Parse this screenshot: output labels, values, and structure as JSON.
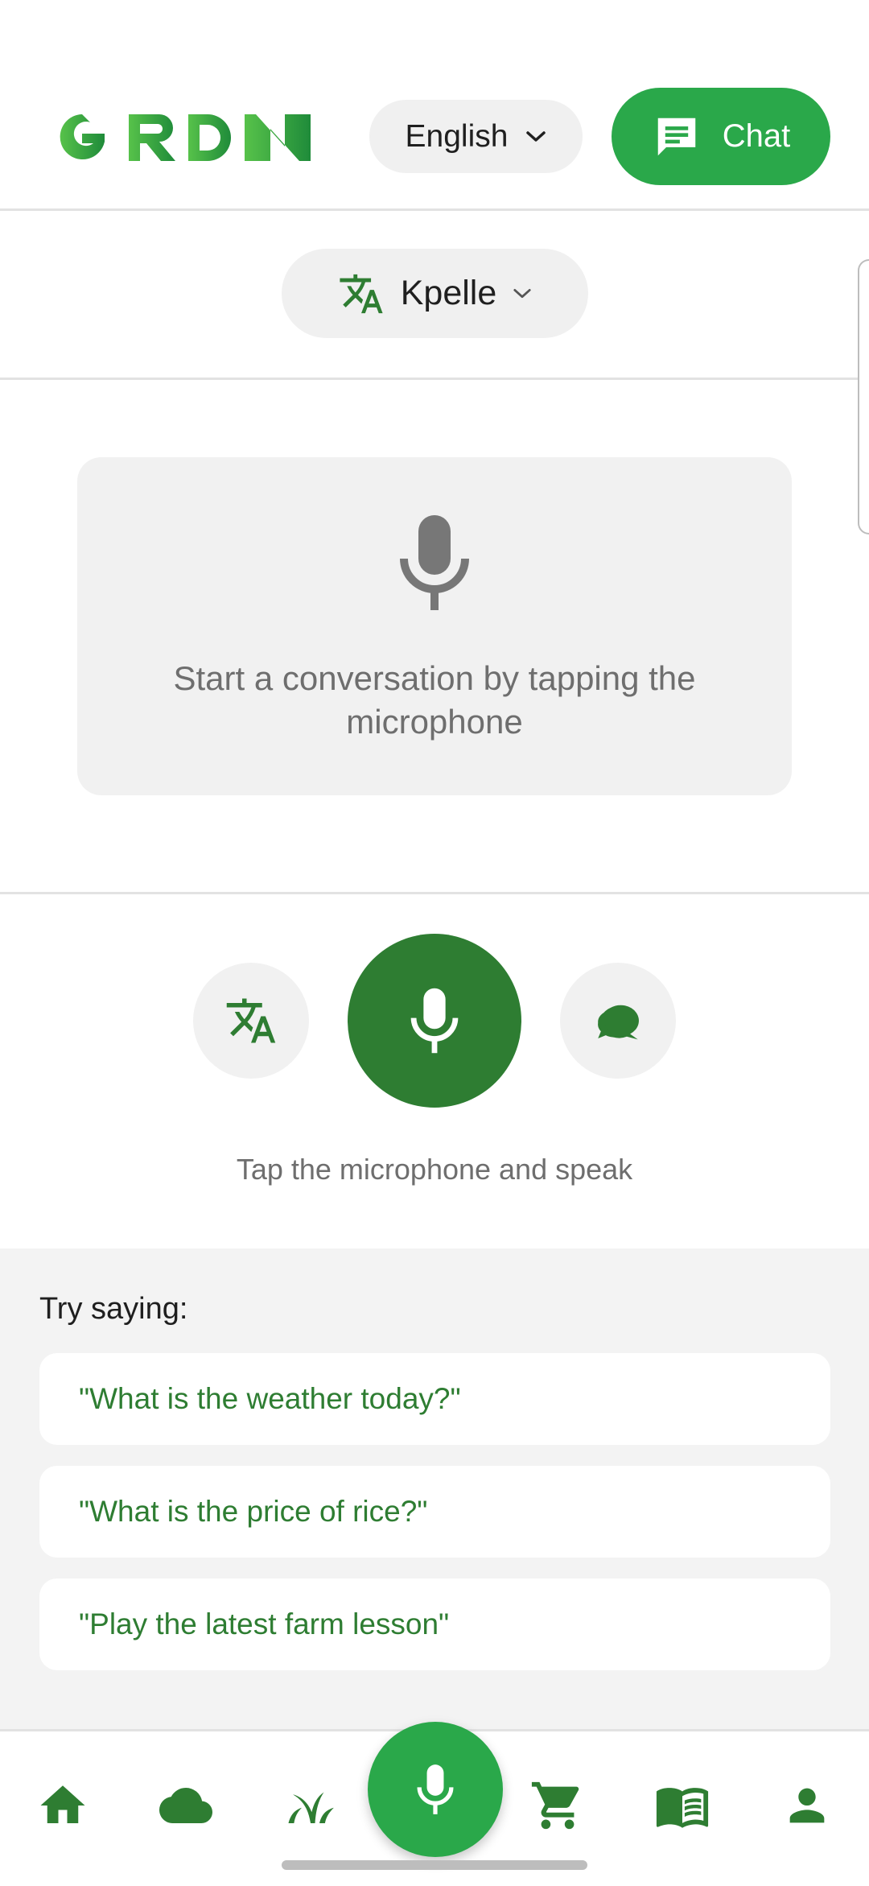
{
  "header": {
    "logo_text": "GRDN",
    "language": "English",
    "chat_label": "Chat"
  },
  "target_language": {
    "label": "Kpelle"
  },
  "conversation": {
    "empty_message": "Start a conversation by tapping the microphone"
  },
  "controls": {
    "hint": "Tap the microphone and speak",
    "icons": [
      "translate-icon",
      "microphone-icon",
      "chat-bubbles-icon"
    ]
  },
  "suggestions": {
    "title": "Try saying:",
    "items": [
      "\"What is the weather today?\"",
      "\"What is the price of rice?\"",
      "\"Play the latest farm lesson\""
    ]
  },
  "bottom_nav": {
    "icons": [
      "home-icon",
      "cloud-icon",
      "crop-icon",
      "microphone-icon",
      "cart-icon",
      "book-icon",
      "profile-icon"
    ]
  },
  "colors": {
    "accent_green": "#2aa84a",
    "dark_green": "#2e7d32",
    "panel_gray": "#f3f3f3"
  }
}
